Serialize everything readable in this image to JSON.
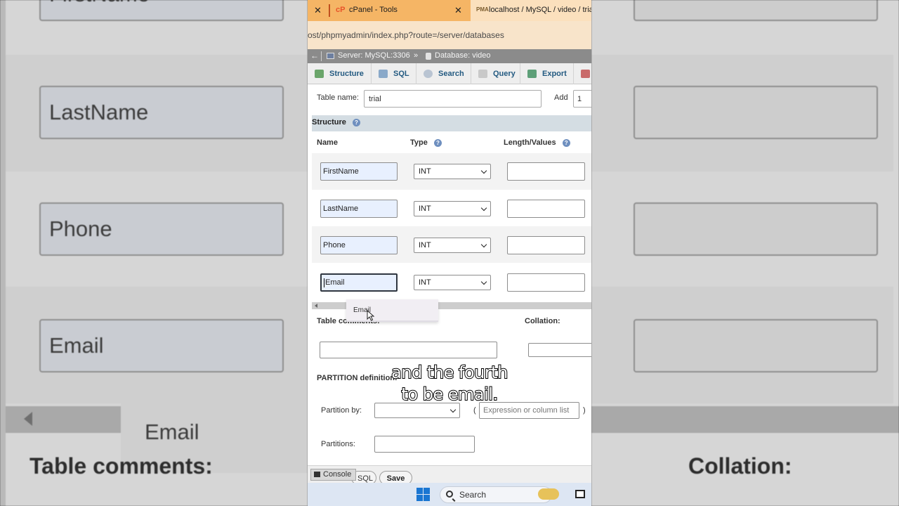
{
  "background": {
    "left_fields": [
      "FirstName",
      "LastName",
      "Phone",
      "Email"
    ],
    "left_popup": "Email",
    "left_label": "Table comments:",
    "right_label": "Collation:"
  },
  "browser": {
    "tab1_label": "cPanel - Tools",
    "tab2_label": "localhost / MySQL / video / trial",
    "address": "ost/phpmyadmin/index.php?route=/server/databases"
  },
  "breadcrumb": {
    "back": "←",
    "server": "Server: MySQL:3306",
    "separator": "»",
    "database": "Database: video"
  },
  "menu": {
    "structure": "Structure",
    "sql": "SQL",
    "search": "Search",
    "query": "Query",
    "export": "Export"
  },
  "form": {
    "table_name_label": "Table name:",
    "table_name_value": "trial",
    "add_label": "Add",
    "add_value": "1",
    "structure_title": "Structure",
    "help": "?",
    "col_name": "Name",
    "col_type": "Type",
    "col_length": "Length/Values",
    "columns": [
      {
        "name": "FirstName",
        "type": "INT"
      },
      {
        "name": "LastName",
        "type": "INT"
      },
      {
        "name": "Phone",
        "type": "INT"
      },
      {
        "name": "Email",
        "type": "INT"
      }
    ],
    "autocomplete": "Email",
    "table_comments_label": "Table comments:",
    "collation_label": "Collation:",
    "partition_definition": "PARTITION definition:",
    "partition_by_label": "Partition by:",
    "open_paren": "(",
    "close_paren": ")",
    "expression_placeholder": "Expression or column list",
    "partitions_label": "Partitions:"
  },
  "bottom": {
    "console": "Console",
    "preview_sql": "SQL",
    "save": "Save"
  },
  "taskbar": {
    "search": "Search"
  },
  "captions": {
    "line1": "and the fourth",
    "line2": "to be email."
  }
}
